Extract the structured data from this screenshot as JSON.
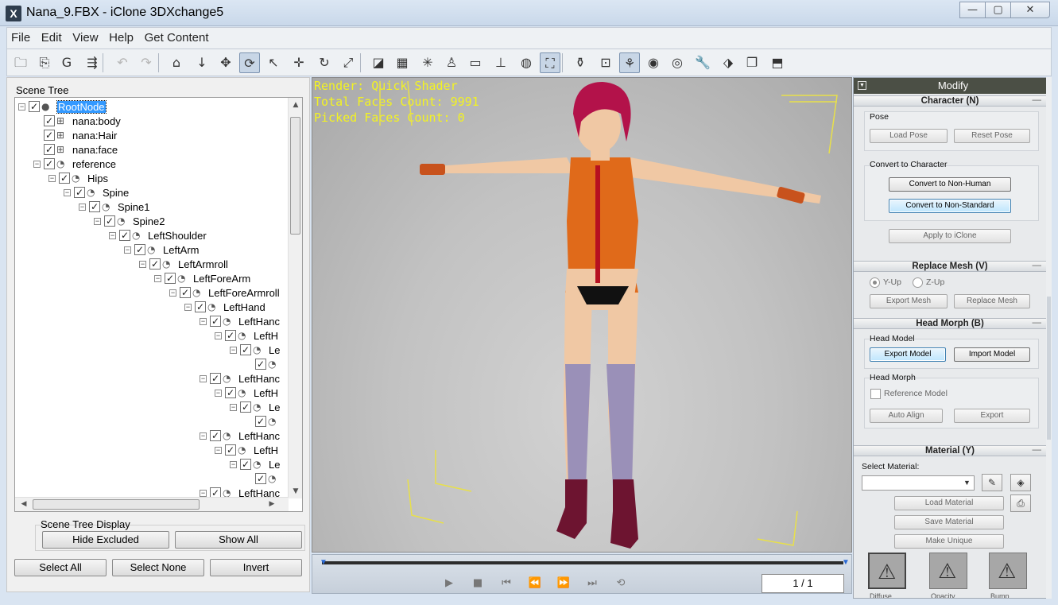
{
  "window": {
    "title": "Nana_9.FBX - iClone 3DXchange5"
  },
  "menu": [
    "File",
    "Edit",
    "View",
    "Help",
    "Get Content"
  ],
  "toolbar": {
    "icons": [
      {
        "name": "open-folder-icon",
        "glyph": "🗀"
      },
      {
        "name": "import-icon",
        "glyph": "⎘"
      },
      {
        "name": "g-icon",
        "glyph": "G"
      },
      {
        "name": "export-icon",
        "glyph": "⇶"
      },
      {
        "name": "undo-icon",
        "glyph": "↶"
      },
      {
        "name": "redo-icon",
        "glyph": "↷"
      },
      {
        "name": "home-icon",
        "glyph": "⌂"
      },
      {
        "name": "drop-down-icon",
        "glyph": "↓"
      },
      {
        "name": "move-icon",
        "glyph": "✥"
      },
      {
        "name": "orbit-icon",
        "glyph": "⟳"
      },
      {
        "name": "pick-icon",
        "glyph": "↖"
      },
      {
        "name": "translate-icon",
        "glyph": "✛"
      },
      {
        "name": "rotate-icon",
        "glyph": "↻"
      },
      {
        "name": "scale-icon",
        "glyph": "⤢"
      },
      {
        "name": "select-box-icon",
        "glyph": "◪"
      },
      {
        "name": "grid-icon",
        "glyph": "▦"
      },
      {
        "name": "axis-icon",
        "glyph": "✳"
      },
      {
        "name": "figure-icon",
        "glyph": "♙"
      },
      {
        "name": "plane-icon",
        "glyph": "▭"
      },
      {
        "name": "pivot-icon",
        "glyph": "⊥"
      },
      {
        "name": "globe-icon",
        "glyph": "◍"
      },
      {
        "name": "frame-selected-icon",
        "glyph": "⛶"
      },
      {
        "name": "character-icon",
        "glyph": "⚱"
      },
      {
        "name": "camera-icon",
        "glyph": "⊡"
      },
      {
        "name": "bone-icon",
        "glyph": "⚘"
      },
      {
        "name": "morph-icon",
        "glyph": "◉"
      },
      {
        "name": "mesh-icon",
        "glyph": "◎"
      },
      {
        "name": "wrench-icon",
        "glyph": "🔧"
      },
      {
        "name": "tag-icon",
        "glyph": "⬗"
      },
      {
        "name": "copy-icon",
        "glyph": "❐"
      },
      {
        "name": "screen-icon",
        "glyph": "⬒"
      }
    ]
  },
  "scene_tree": {
    "label": "Scene Tree",
    "rows": [
      {
        "label": "RootNode",
        "icon": "●",
        "selected": true
      },
      {
        "label": "nana:body",
        "icon": "⊞"
      },
      {
        "label": "nana:Hair",
        "icon": "⊞"
      },
      {
        "label": "nana:face",
        "icon": "⊞"
      },
      {
        "label": "reference",
        "icon": "◔"
      },
      {
        "label": "Hips",
        "icon": "◔"
      },
      {
        "label": "Spine",
        "icon": "◔"
      },
      {
        "label": "Spine1",
        "icon": "◔"
      },
      {
        "label": "Spine2",
        "icon": "◔"
      },
      {
        "label": "LeftShoulder",
        "icon": "◔"
      },
      {
        "label": "LeftArm",
        "icon": "◔"
      },
      {
        "label": "LeftArmroll",
        "icon": "◔"
      },
      {
        "label": "LeftForeArm",
        "icon": "◔"
      },
      {
        "label": "LeftForeArmroll",
        "icon": "◔"
      },
      {
        "label": "LeftHand",
        "icon": "◔"
      },
      {
        "label": "LeftHanc",
        "icon": "◔"
      },
      {
        "label": "LeftH",
        "icon": "◔"
      },
      {
        "label": "Le",
        "icon": "◔"
      },
      {
        "label": "",
        "icon": "◔"
      },
      {
        "label": "LeftHanc",
        "icon": "◔"
      },
      {
        "label": "LeftH",
        "icon": "◔"
      },
      {
        "label": "Le",
        "icon": "◔"
      },
      {
        "label": "",
        "icon": "◔"
      },
      {
        "label": "LeftHanc",
        "icon": "◔"
      },
      {
        "label": "LeftH",
        "icon": "◔"
      },
      {
        "label": "Le",
        "icon": "◔"
      },
      {
        "label": "",
        "icon": "◔"
      },
      {
        "label": "LeftHanc",
        "icon": "◔"
      }
    ],
    "display_label": "Scene Tree Display",
    "hide_excluded": "Hide Excluded",
    "show_all": "Show All",
    "select_all": "Select All",
    "select_none": "Select None",
    "invert": "Invert"
  },
  "viewport": {
    "render": "Render: Quick Shader",
    "total_faces": "Total Faces Count: 9991",
    "picked_faces": "Picked Faces Count: 0",
    "colors": {
      "overlay_text": "#f3f321",
      "hair": "#b3124a",
      "suit": "#e06a1a",
      "socks": "#9a90b8",
      "boots": "#6d1430",
      "skin": "#f0c8a4"
    }
  },
  "timeline": {
    "frame": "1 / 1"
  },
  "modify": {
    "title": "Modify",
    "character": {
      "header": "Character (N)",
      "pose_label": "Pose",
      "load_pose": "Load Pose",
      "reset_pose": "Reset Pose",
      "convert_label": "Convert to Character",
      "non_human": "Convert to Non-Human",
      "non_standard": "Convert to Non-Standard",
      "apply": "Apply to iClone"
    },
    "replace_mesh": {
      "header": "Replace Mesh (V)",
      "y_up": "Y-Up",
      "z_up": "Z-Up",
      "export_mesh": "Export Mesh",
      "replace_mesh": "Replace Mesh"
    },
    "head_morph": {
      "header": "Head Morph (B)",
      "head_model_label": "Head Model",
      "export_model": "Export Model",
      "import_model": "Import Model",
      "head_morph_label": "Head Morph",
      "reference_model": "Reference Model",
      "auto_align": "Auto Align",
      "export": "Export"
    },
    "material": {
      "header": "Material (Y)",
      "select_label": "Select Material:",
      "load": "Load Material",
      "save": "Save Material",
      "unique": "Make Unique",
      "textures": [
        "Diffuse",
        "Opacity",
        "Bump"
      ]
    }
  }
}
